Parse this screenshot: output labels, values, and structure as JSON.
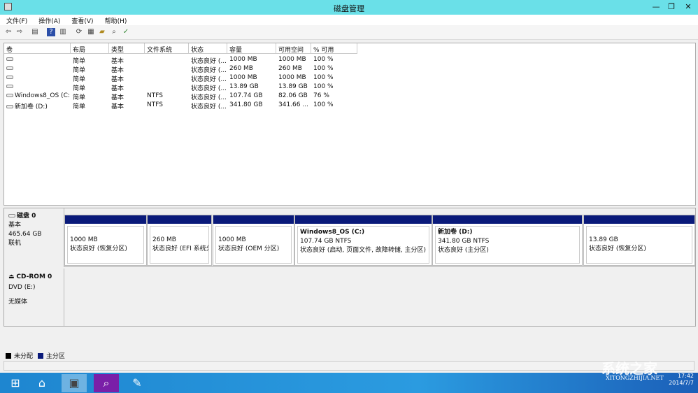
{
  "window": {
    "title": "磁盘管理",
    "minimize": "—",
    "restore": "❐",
    "close": "✕"
  },
  "menu": [
    "文件(F)",
    "操作(A)",
    "查看(V)",
    "帮助(H)"
  ],
  "toolbar_icons": [
    "back-icon",
    "forward-icon",
    "console-tree-icon",
    "help-icon",
    "action-pane-icon",
    "refresh-icon",
    "properties-icon",
    "open-icon",
    "search-icon",
    "settings-icon"
  ],
  "list": {
    "columns": [
      "卷",
      "布局",
      "类型",
      "文件系统",
      "状态",
      "容量",
      "可用空间",
      "% 可用"
    ],
    "rows": [
      [
        "",
        "简单",
        "基本",
        "",
        "状态良好 (...",
        "1000 MB",
        "1000 MB",
        "100 %"
      ],
      [
        "",
        "简单",
        "基本",
        "",
        "状态良好 (...",
        "260 MB",
        "260 MB",
        "100 %"
      ],
      [
        "",
        "简单",
        "基本",
        "",
        "状态良好 (...",
        "1000 MB",
        "1000 MB",
        "100 %"
      ],
      [
        "",
        "简单",
        "基本",
        "",
        "状态良好 (...",
        "13.89 GB",
        "13.89 GB",
        "100 %"
      ],
      [
        "Windows8_OS (C:)",
        "简单",
        "基本",
        "NTFS",
        "状态良好 (...",
        "107.74 GB",
        "82.06 GB",
        "76 %"
      ],
      [
        "新加卷 (D:)",
        "简单",
        "基本",
        "NTFS",
        "状态良好 (...",
        "341.80 GB",
        "341.66 ...",
        "100 %"
      ]
    ]
  },
  "disk0": {
    "name": "磁盘 0",
    "type": "基本",
    "size": "465.64 GB",
    "state": "联机",
    "partitions": [
      {
        "title": "",
        "size": "1000 MB",
        "status": "状态良好 (恢复分区)"
      },
      {
        "title": "",
        "size": "260 MB",
        "status": "状态良好 (EFI 系统分"
      },
      {
        "title": "",
        "size": "1000 MB",
        "status": "状态良好 (OEM 分区)"
      },
      {
        "title": "Windows8_OS  (C:)",
        "size": "107.74 GB NTFS",
        "status": "状态良好 (启动, 页面文件, 故障转储, 主分区)"
      },
      {
        "title": "新加卷  (D:)",
        "size": "341.80 GB NTFS",
        "status": "状态良好 (主分区)"
      },
      {
        "title": "",
        "size": "13.89 GB",
        "status": "状态良好 (恢复分区)"
      }
    ]
  },
  "cdrom0": {
    "name": "CD-ROM 0",
    "drive": "DVD (E:)",
    "media": "无媒体"
  },
  "legend": [
    {
      "label": "未分配",
      "color": "#000000"
    },
    {
      "label": "主分区",
      "color": "#0a1a7a"
    }
  ],
  "tray": {
    "time": "17:42",
    "date": "2014/7/7"
  },
  "watermark": {
    "text": "系统之家",
    "url": "XITONGZHIJIA.NET"
  }
}
